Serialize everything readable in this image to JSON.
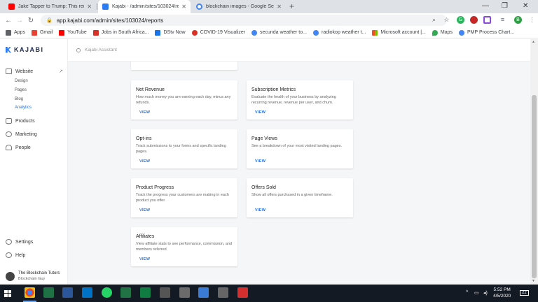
{
  "browser": {
    "tabs": [
      {
        "title": "Jake Tapper to Trump: This requi",
        "favicon_color": "#ff0000",
        "active": false
      },
      {
        "title": "Kajabi - /admin/sites/103024/rep",
        "favicon_color": "#2b7bf3",
        "active": true
      },
      {
        "title": "blockchain images - Google Sear",
        "favicon_color": "#4285f4",
        "active": false
      }
    ],
    "new_tab_symbol": "+",
    "url": "app.kajabi.com/admin/sites/103024/reports",
    "profile_initial": "B",
    "bookmarks": [
      {
        "label": "Apps",
        "color": "#5f6368"
      },
      {
        "label": "Gmail",
        "color": "#ea4335"
      },
      {
        "label": "YouTube",
        "color": "#ff0000"
      },
      {
        "label": "Jobs in South Africa...",
        "color": "#d93025"
      },
      {
        "label": "DStv Now",
        "color": "#1a73e8"
      },
      {
        "label": "COVID-19 Visualizer",
        "color": "#d93025"
      },
      {
        "label": "secunda weather to...",
        "color": "#4285f4"
      },
      {
        "label": "radiokop weather t...",
        "color": "#4285f4"
      },
      {
        "label": "Microsoft account |...",
        "color": "#f25022"
      },
      {
        "label": "Maps",
        "color": "#34a853"
      },
      {
        "label": "PMP Process Chart...",
        "color": "#4285f4"
      }
    ]
  },
  "app": {
    "brand": "KAJABI",
    "search_placeholder": "Kajabi Assistant",
    "nav": {
      "website": "Website",
      "sub": [
        "Design",
        "Pages",
        "Blog",
        "Analytics"
      ],
      "products": "Products",
      "marketing": "Marketing",
      "people": "People",
      "settings": "Settings",
      "help": "Help"
    },
    "user": {
      "name": "The Blockchain Tutors",
      "role": "Blockchain Guy"
    },
    "accent_color": "#2a6fdb",
    "cards": [
      {
        "title": "Net Revenue",
        "desc": "How much money you are earning each day, minus any refunds.",
        "link": "VIEW"
      },
      {
        "title": "Subscription Metrics",
        "desc": "Evaluate the health of your business by analyzing recurring revenue, revenue per user, and churn.",
        "link": "VIEW"
      },
      {
        "title": "Opt-ins",
        "desc": "Track submissions to your forms and specific landing pages.",
        "link": "VIEW"
      },
      {
        "title": "Page Views",
        "desc": "See a breakdown of your most visited landing pages.",
        "link": "VIEW"
      },
      {
        "title": "Product Progress",
        "desc": "Track the progress your customers are making in each product you offer.",
        "link": "VIEW"
      },
      {
        "title": "Offers Sold",
        "desc": "Show all offers purchased in a given timeframe.",
        "link": "VIEW"
      },
      {
        "title": "Affiliates",
        "desc": "View affiliate stats to see performance, commission, and members referred",
        "link": "VIEW"
      }
    ]
  },
  "taskbar": {
    "time": "5:52 PM",
    "date": "4/5/2020",
    "notification_count": "22"
  }
}
